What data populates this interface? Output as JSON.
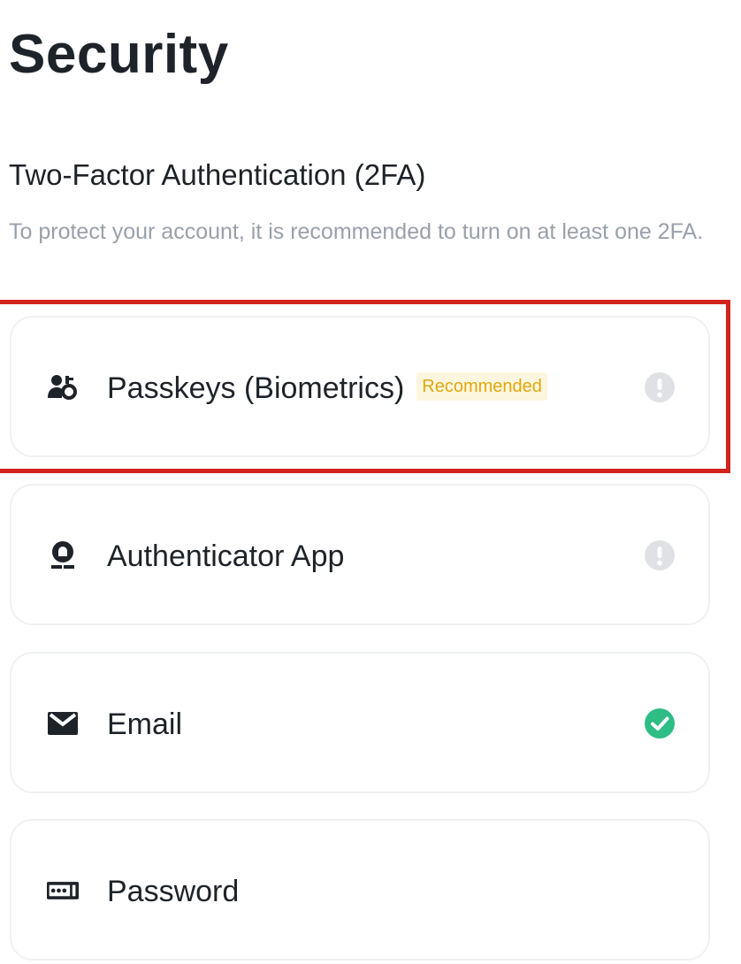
{
  "header": {
    "title": "Security"
  },
  "section": {
    "title": "Two-Factor Authentication (2FA)",
    "description": "To protect your account, it is recommended to turn on at least one 2FA."
  },
  "methods": [
    {
      "label": "Passkeys (Biometrics)",
      "badge": "Recommended",
      "icon": "passkey-icon",
      "status": "warning",
      "highlighted": true
    },
    {
      "label": "Authenticator App",
      "icon": "authenticator-icon",
      "status": "warning"
    },
    {
      "label": "Email",
      "icon": "email-icon",
      "status": "enabled"
    },
    {
      "label": "Password",
      "icon": "password-icon",
      "status": "none"
    }
  ],
  "colors": {
    "text_primary": "#1e2329",
    "text_secondary": "#9aa0ab",
    "badge_text": "#e0a80d",
    "badge_bg": "#fdf6df",
    "status_warning": "#dfe1e5",
    "status_enabled": "#2ebd85",
    "highlight_border": "#d2231c",
    "card_border": "#eef0f2"
  }
}
